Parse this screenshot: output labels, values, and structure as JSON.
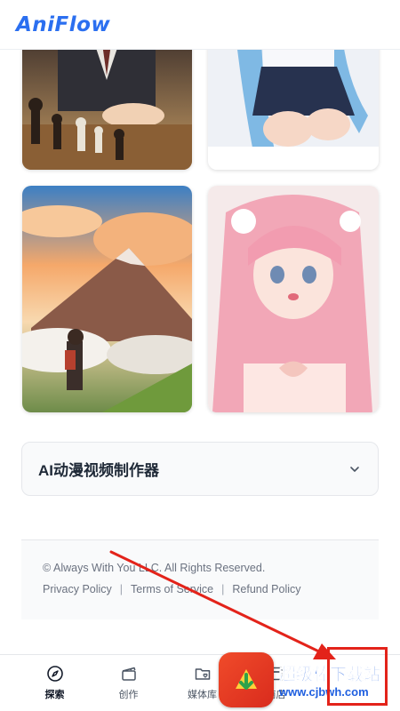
{
  "header": {
    "logo": "AniFlow"
  },
  "gallery": [
    {
      "name": "chess-player-artwork",
      "alt": "anime chess scene"
    },
    {
      "name": "blue-hair-girl-artwork",
      "alt": "anime girl sitting"
    },
    {
      "name": "mountain-sunset-artwork",
      "alt": "anime mountain landscape"
    },
    {
      "name": "pink-hair-girl-artwork",
      "alt": "anime girl heart hands"
    }
  ],
  "accordion": {
    "title": "AI动漫视频制作器"
  },
  "footer": {
    "copyright": "© Always With You LLC. All Rights Reserved.",
    "links": [
      "Privacy Policy",
      "Terms of Service",
      "Refund Policy"
    ]
  },
  "tabbar": {
    "items": [
      {
        "label": "探索",
        "icon": "compass-icon",
        "active": true
      },
      {
        "label": "创作",
        "icon": "clapperboard-icon",
        "active": false
      },
      {
        "label": "媒体库",
        "icon": "folder-heart-icon",
        "active": false
      },
      {
        "label": "商店",
        "icon": "store-icon",
        "active": false
      }
    ]
  },
  "watermark": {
    "title": "超级棒下载站",
    "url": "www.cjbwh.com"
  },
  "colors": {
    "accent": "#2b6ff0",
    "annotation": "#e3231a"
  }
}
